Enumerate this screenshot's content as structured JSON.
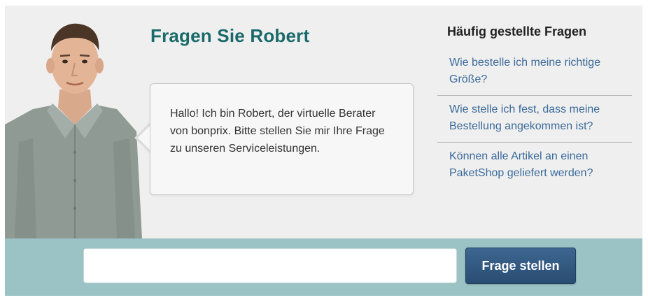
{
  "assistant": {
    "title": "Fragen Sie Robert",
    "greeting": "Hallo! Ich bin Robert, der virtuelle Berater von bonprix. Bitte stellen Sie mir Ihre Frage zu unseren Serviceleistungen."
  },
  "faq": {
    "heading": "Häufig gestellte Fragen",
    "items": [
      {
        "label": "Wie bestelle ich meine richtige Größe?"
      },
      {
        "label": "Wie stelle ich fest, dass meine Bestellung angekommen ist?"
      },
      {
        "label": "Können alle Artikel an einen PaketShop geliefert werden?"
      }
    ]
  },
  "question_form": {
    "input_value": "",
    "input_placeholder": "",
    "submit_label": "Frage stellen"
  },
  "colors": {
    "title": "#1a6a6a",
    "link": "#3a6a9a",
    "bottom_bar": "#9bc3c6",
    "button": "#2f5579"
  }
}
